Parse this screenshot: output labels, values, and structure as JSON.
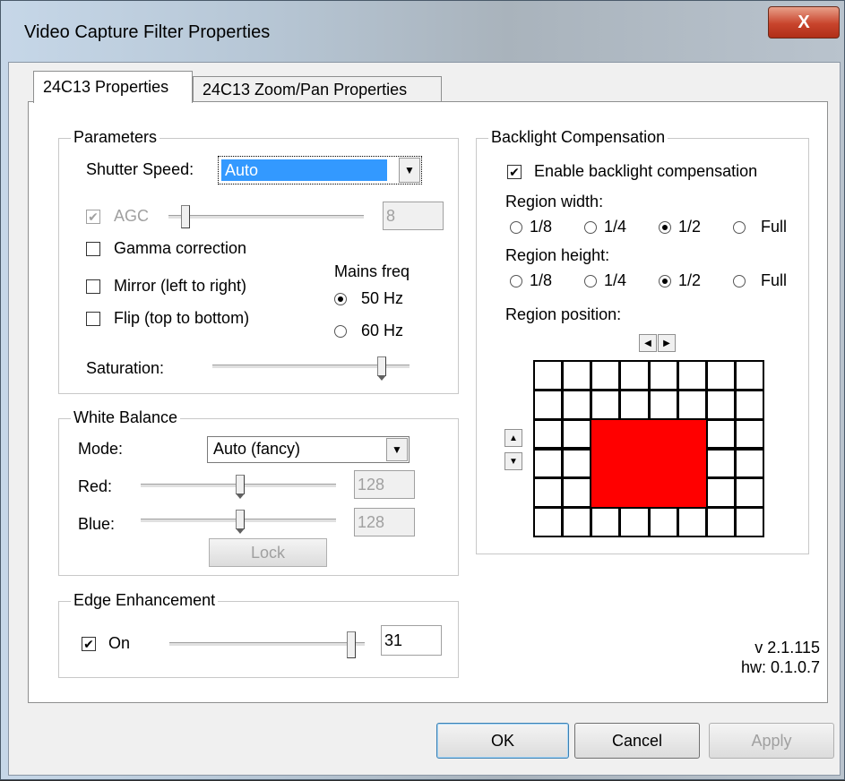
{
  "window": {
    "title": "Video Capture Filter Properties",
    "close_label": "X"
  },
  "tabs": [
    {
      "label": "24C13 Properties",
      "active": true
    },
    {
      "label": "24C13 Zoom/Pan Properties",
      "active": false
    }
  ],
  "parameters": {
    "title": "Parameters",
    "shutter_label": "Shutter Speed:",
    "shutter_value": "Auto",
    "agc_label": "AGC",
    "agc_value": "8",
    "gamma_label": "Gamma correction",
    "mirror_label": "Mirror (left to right)",
    "flip_label": "Flip (top to bottom)",
    "mains_label": "Mains freq",
    "mains_options": [
      "50 Hz",
      "60 Hz"
    ],
    "mains_selected": "50 Hz",
    "saturation_label": "Saturation:"
  },
  "white_balance": {
    "title": "White Balance",
    "mode_label": "Mode:",
    "mode_value": "Auto (fancy)",
    "red_label": "Red:",
    "red_value": "128",
    "blue_label": "Blue:",
    "blue_value": "128",
    "lock_label": "Lock"
  },
  "edge": {
    "title": "Edge Enhancement",
    "on_label": "On",
    "value": "31"
  },
  "backlight": {
    "title": "Backlight Compensation",
    "enable_label": "Enable backlight compensation",
    "width_label": "Region width:",
    "height_label": "Region height:",
    "options": [
      "1/8",
      "1/4",
      "1/2",
      "Full"
    ],
    "width_selected": "1/2",
    "height_selected": "1/2",
    "position_label": "Region position:",
    "left_arrow": "◀",
    "right_arrow": "▶",
    "up_arrow": "▲",
    "down_arrow": "▼",
    "region_color": "#ff0000"
  },
  "version": {
    "version": "v 2.1.115",
    "hw": "hw: 0.1.0.7"
  },
  "buttons": {
    "ok": "OK",
    "cancel": "Cancel",
    "apply": "Apply"
  }
}
